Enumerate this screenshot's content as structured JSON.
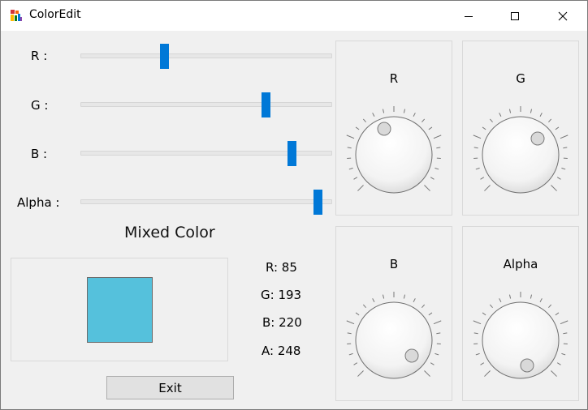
{
  "window": {
    "title": "ColorEdit"
  },
  "sliders": [
    {
      "label": "R :",
      "value": 85
    },
    {
      "label": "G :",
      "value": 193
    },
    {
      "label": "B :",
      "value": 220
    },
    {
      "label": "Alpha :",
      "value": 248
    }
  ],
  "mixed": {
    "title": "Mixed Color",
    "swatch_color": "#55c1dc",
    "values": [
      "R: 85",
      "G: 193",
      "B: 220",
      "A: 248"
    ]
  },
  "exit_label": "Exit",
  "knobs": [
    {
      "label": "R"
    },
    {
      "label": "G"
    },
    {
      "label": "B"
    },
    {
      "label": "Alpha"
    }
  ],
  "accent_color": "#0078d7"
}
